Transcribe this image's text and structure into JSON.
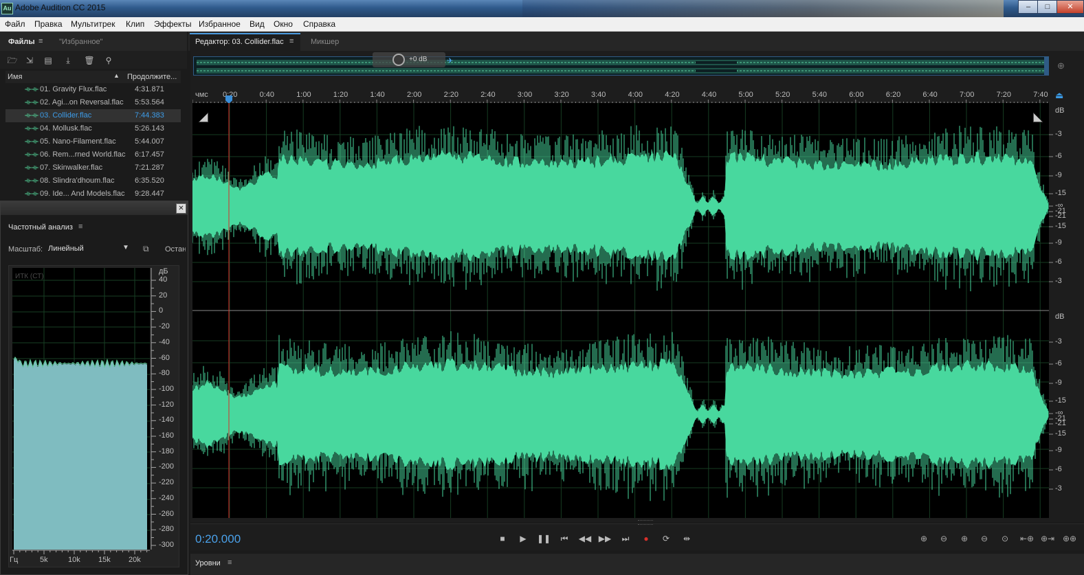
{
  "window": {
    "title": "Adobe Audition CC 2015",
    "app_icon": "Au",
    "minimize": "–",
    "maximize": "□",
    "close": "✕"
  },
  "menu": [
    "Файл",
    "Правка",
    "Мультитрек",
    "Клип",
    "Эффекты",
    "Избранное",
    "Вид",
    "Окно",
    "Справка"
  ],
  "files_panel": {
    "tab_files": "Файлы",
    "tab_favorites": "\"Избранное\"",
    "col_name": "Имя",
    "col_duration": "Продолжите...",
    "files": [
      {
        "name": "01. Gravity Flux.flac",
        "duration": "4:31.871"
      },
      {
        "name": "02. Agi...on Reversal.flac",
        "duration": "5:53.564"
      },
      {
        "name": "03. Collider.flac",
        "duration": "7:44.383",
        "selected": true
      },
      {
        "name": "04. Mollusk.flac",
        "duration": "5:26.143"
      },
      {
        "name": "05. Nano-Filament.flac",
        "duration": "5:44.007"
      },
      {
        "name": "06. Rem...rned World.flac",
        "duration": "6:17.457"
      },
      {
        "name": "07. Skinwalker.flac",
        "duration": "7:21.287"
      },
      {
        "name": "08. Slindra'dhoum.flac",
        "duration": "6:35.520"
      },
      {
        "name": "09. Ide... And Models.flac",
        "duration": "9:28.447"
      }
    ]
  },
  "frequency_panel": {
    "title": "Частотный анализ",
    "scale_label": "Масштаб:",
    "scale_value": "Линейный",
    "stop_label": "Останов",
    "overlay": "ИТК (СТ)",
    "db_unit": "дБ",
    "db_ticks": [
      "40",
      "20",
      "0",
      "-20",
      "-40",
      "-60",
      "-80",
      "-100",
      "-120",
      "-140",
      "-160",
      "-180",
      "-200",
      "-220",
      "-240",
      "-260",
      "-280",
      "-300"
    ],
    "freq_unit": "Гц",
    "freq_ticks": [
      "5k",
      "10k",
      "15k",
      "20k"
    ],
    "close": "✕"
  },
  "editor": {
    "tab_editor": "Редактор: 03. Collider.flac",
    "tab_mixer": "Микшер",
    "gain": "+0 dB",
    "ruler_unit": "чмс",
    "ruler_ticks": [
      "0:20",
      "0:40",
      "1:00",
      "1:20",
      "1:40",
      "2:00",
      "2:20",
      "2:40",
      "3:00",
      "3:20",
      "3:40",
      "4:00",
      "4:20",
      "4:40",
      "5:00",
      "5:20",
      "5:40",
      "6:00",
      "6:20",
      "6:40",
      "7:00",
      "7:20",
      "7:40"
    ],
    "db_unit": "dB",
    "db_scale": [
      "-3",
      "-6",
      "-9",
      "-15",
      "-21",
      "-∞",
      "-21",
      "-15",
      "-9",
      "-6",
      "-3"
    ],
    "waveform_color": "#48d89e",
    "playhead_color": "#d9302b",
    "current_time": "0:20.000"
  },
  "levels_panel": {
    "title": "Уровни"
  }
}
